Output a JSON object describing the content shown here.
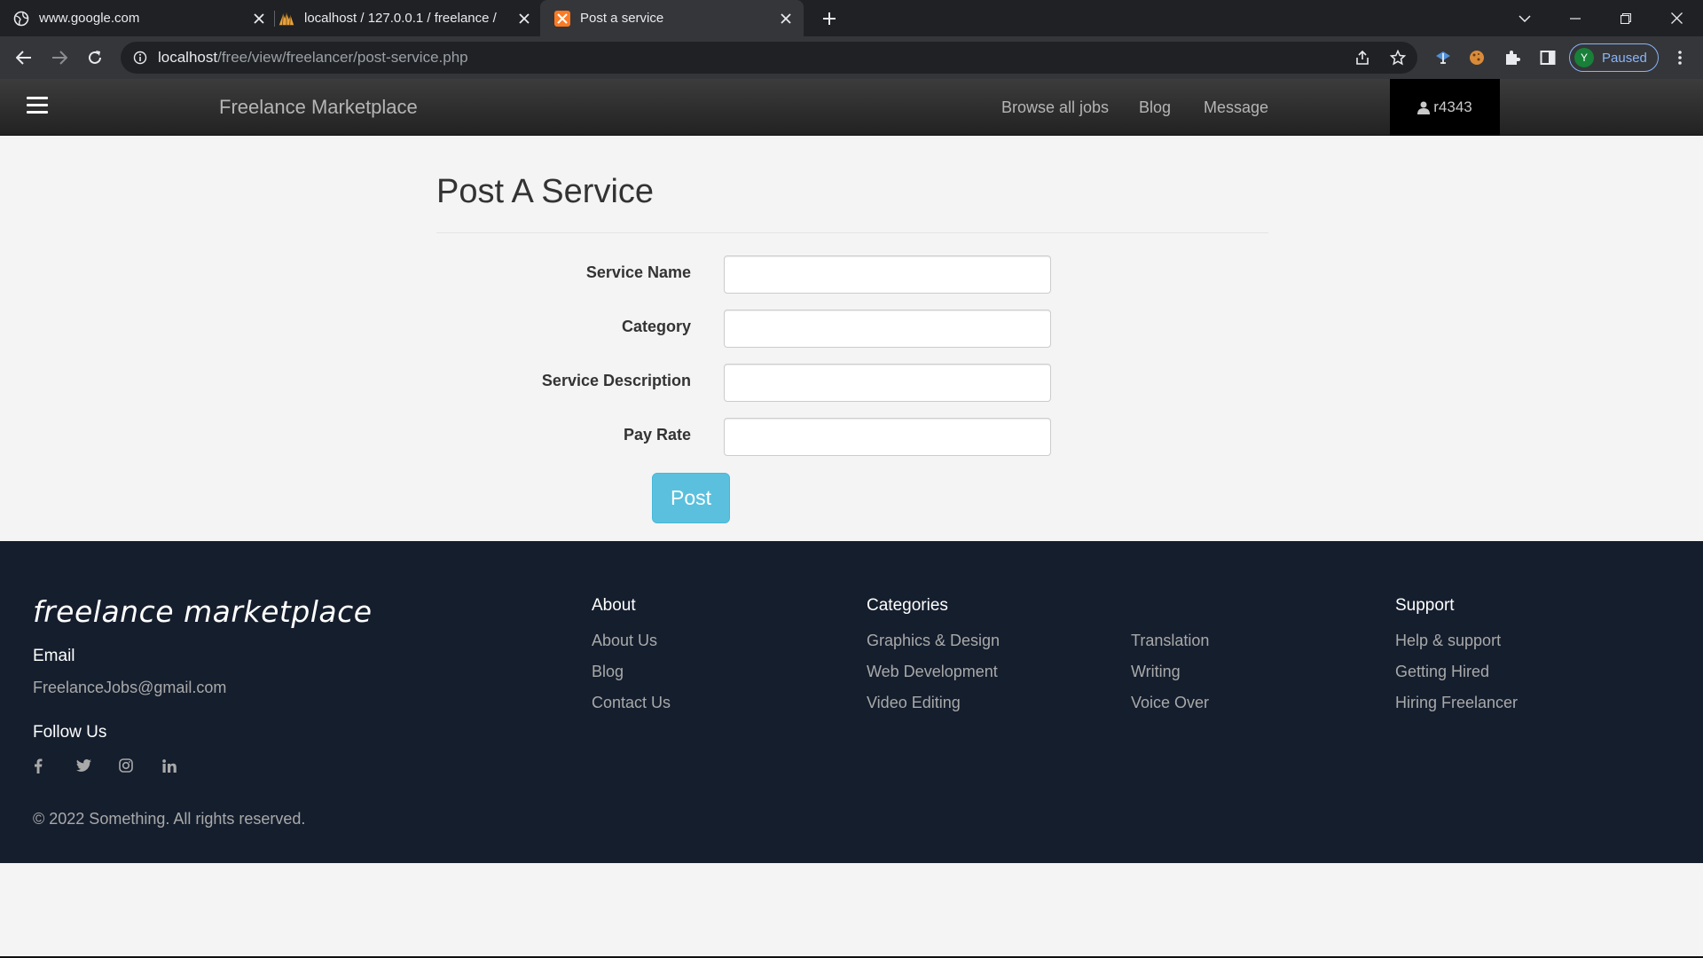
{
  "browser": {
    "tabs": [
      {
        "title": "www.google.com",
        "favicon": "globe-icon",
        "active": false
      },
      {
        "title": "localhost / 127.0.0.1 / freelance /",
        "favicon": "phpmyadmin-icon",
        "active": false
      },
      {
        "title": "Post a service",
        "favicon": "xampp-icon",
        "active": true
      }
    ],
    "url_host": "localhost",
    "url_path": "/free/view/freelancer/post-service.php",
    "profile_initial": "Y",
    "profile_status": "Paused"
  },
  "navbar": {
    "brand": "Freelance Marketplace",
    "links": [
      "Browse all jobs",
      "Blog",
      "Message"
    ],
    "username": "r4343"
  },
  "form": {
    "title": "Post A Service",
    "fields": [
      {
        "label": "Service Name",
        "value": ""
      },
      {
        "label": "Category",
        "value": ""
      },
      {
        "label": "Service Description",
        "value": ""
      },
      {
        "label": "Pay Rate",
        "value": ""
      }
    ],
    "submit_label": "Post"
  },
  "footer": {
    "brand": "freelance marketplace",
    "email_heading": "Email",
    "email": "FreelanceJobs@gmail.com",
    "follow_heading": "Follow Us",
    "social": [
      "facebook-icon",
      "twitter-icon",
      "instagram-icon",
      "linkedin-icon"
    ],
    "about": {
      "heading": "About",
      "links": [
        "About Us",
        "Blog",
        "Contact Us"
      ]
    },
    "categories": {
      "heading": "Categories",
      "col1": [
        "Graphics & Design",
        "Web Development",
        "Video Editing"
      ],
      "col2": [
        "Translation",
        "Writing",
        "Voice Over"
      ]
    },
    "support": {
      "heading": "Support",
      "links": [
        "Help & support",
        "Getting Hired",
        "Hiring Freelancer"
      ]
    },
    "copyright": "© 2022 Something. All rights reserved."
  },
  "colors": {
    "chrome_bg": "#202124",
    "navbar_bg": "#2d2d2d",
    "footer_bg": "#151e2d",
    "button": "#5bc0de"
  }
}
